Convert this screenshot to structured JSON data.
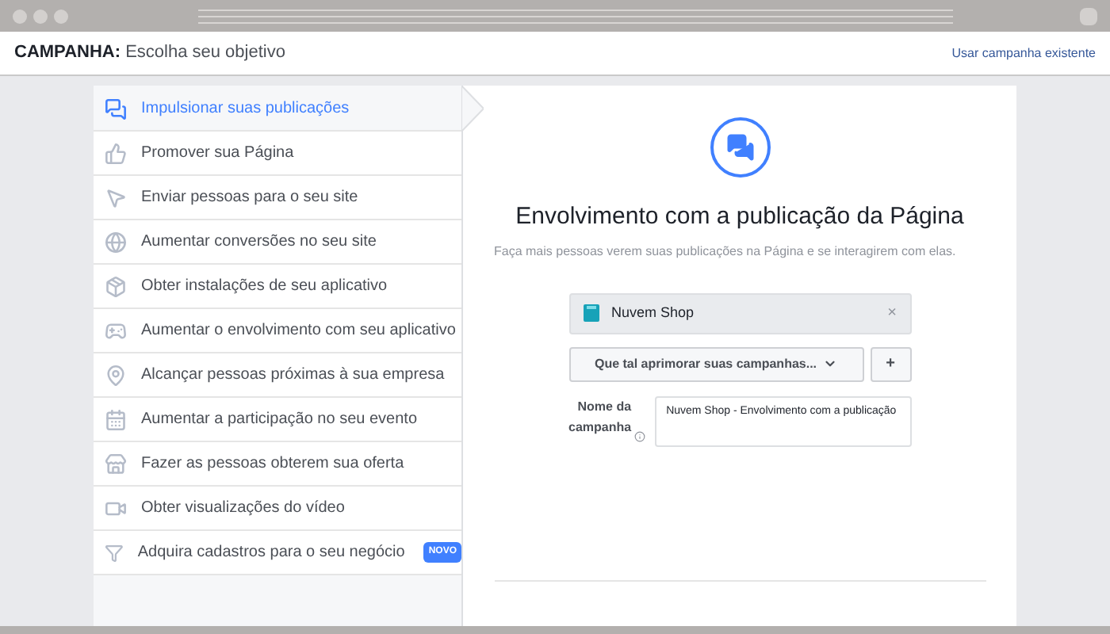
{
  "header": {
    "title": "**CAMPANHA:** Escolha seu objetivo",
    "link": "Usar campanha existente"
  },
  "objectives": [
    {
      "label": "Impulsionar suas publicações",
      "selected": true
    },
    {
      "label": "Promover sua Página",
      "selected": false
    },
    {
      "label": "Enviar pessoas para o seu site",
      "selected": false
    },
    {
      "label": "Aumentar conversões no seu site",
      "selected": false
    },
    {
      "label": "Obter instalações de seu aplicativo",
      "selected": false
    },
    {
      "label": "Aumentar o envolvimento com seu aplicativo",
      "selected": false
    },
    {
      "label": "Alcançar pessoas próximas à sua empresa",
      "selected": false
    },
    {
      "label": "Aumentar a participação no seu evento",
      "selected": false
    },
    {
      "label": "Fazer as pessoas obterem sua oferta",
      "selected": false
    },
    {
      "label": "Obter visualizações do vídeo",
      "selected": false
    },
    {
      "label": "Adquira cadastros para o seu negócio",
      "selected": false,
      "badge": "NOVO"
    }
  ],
  "detail": {
    "title": "Envolvimento com a publicação da Página",
    "description": "Faça mais pessoas verem suas publicações na Página e se interagirem com elas.",
    "page_chip": {
      "name": "Nuvem Shop",
      "remove": "×"
    },
    "dropdown": "Que tal aprimorar suas campanhas...",
    "add_button": "+",
    "campaign_name": {
      "label": "Nome da campanha",
      "value": "Nuvem Shop - Envolvimento com a publicação"
    }
  }
}
